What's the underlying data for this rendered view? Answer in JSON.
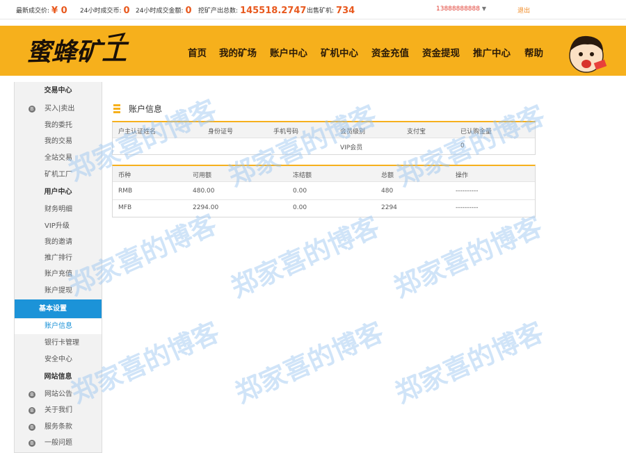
{
  "topbar": {
    "latest_price_label": "最新成交价:",
    "latest_price_value": "¥ 0",
    "coin_24h_label": "24小时成交币:",
    "coin_24h_value": "0",
    "amount_24h_label": "24小时成交金额:",
    "amount_24h_value": "0",
    "mined_total_label": "挖矿产出总数:",
    "mined_total_value": "145518.2747",
    "sold_miners_label": "出售矿机:",
    "sold_miners_value": "734",
    "phone": "13888888888",
    "logout": "退出"
  },
  "header": {
    "logo_text": "蜜蜂矿工",
    "nav": [
      "首页",
      "我的矿场",
      "账户中心",
      "矿机中心",
      "资金充值",
      "资金提现",
      "推广中心",
      "帮助"
    ]
  },
  "sidebar": {
    "trade_head": "交易中心",
    "trade_items": [
      "买入|卖出",
      "我的委托",
      "我的交易",
      "全站交易",
      "矿机工厂"
    ],
    "user_head": "用户中心",
    "user_items": [
      "财务明细",
      "VIP升级",
      "我的邀请",
      "推广排行",
      "账户充值",
      "账户提现"
    ],
    "settings_head": "基本设置",
    "settings_items": [
      "账户信息",
      "银行卡管理",
      "安全中心"
    ],
    "site_head": "网站信息",
    "site_items": [
      "网站公告",
      "关于我们",
      "服务条款",
      "一般问题"
    ]
  },
  "account": {
    "title": "账户信息",
    "headers": [
      "户主认证姓名",
      "身份证号",
      "手机号码",
      "会员级别",
      "支付宝",
      "已认购金量"
    ],
    "row": [
      "",
      "",
      "",
      "VIP会员",
      "",
      "0"
    ]
  },
  "balances": {
    "headers": [
      "币种",
      "可用额",
      "冻结额",
      "总额",
      "操作"
    ],
    "rows": [
      [
        "RMB",
        "480.00",
        "0.00",
        "480",
        "----------"
      ],
      [
        "MFB",
        "2294.00",
        "0.00",
        "2294",
        "----------"
      ]
    ]
  },
  "watermark": "郑家喜的博客",
  "colors": {
    "header_bg": "#f6b01c",
    "accent_orange": "#e8591e",
    "active_blue": "#1c93d8"
  }
}
